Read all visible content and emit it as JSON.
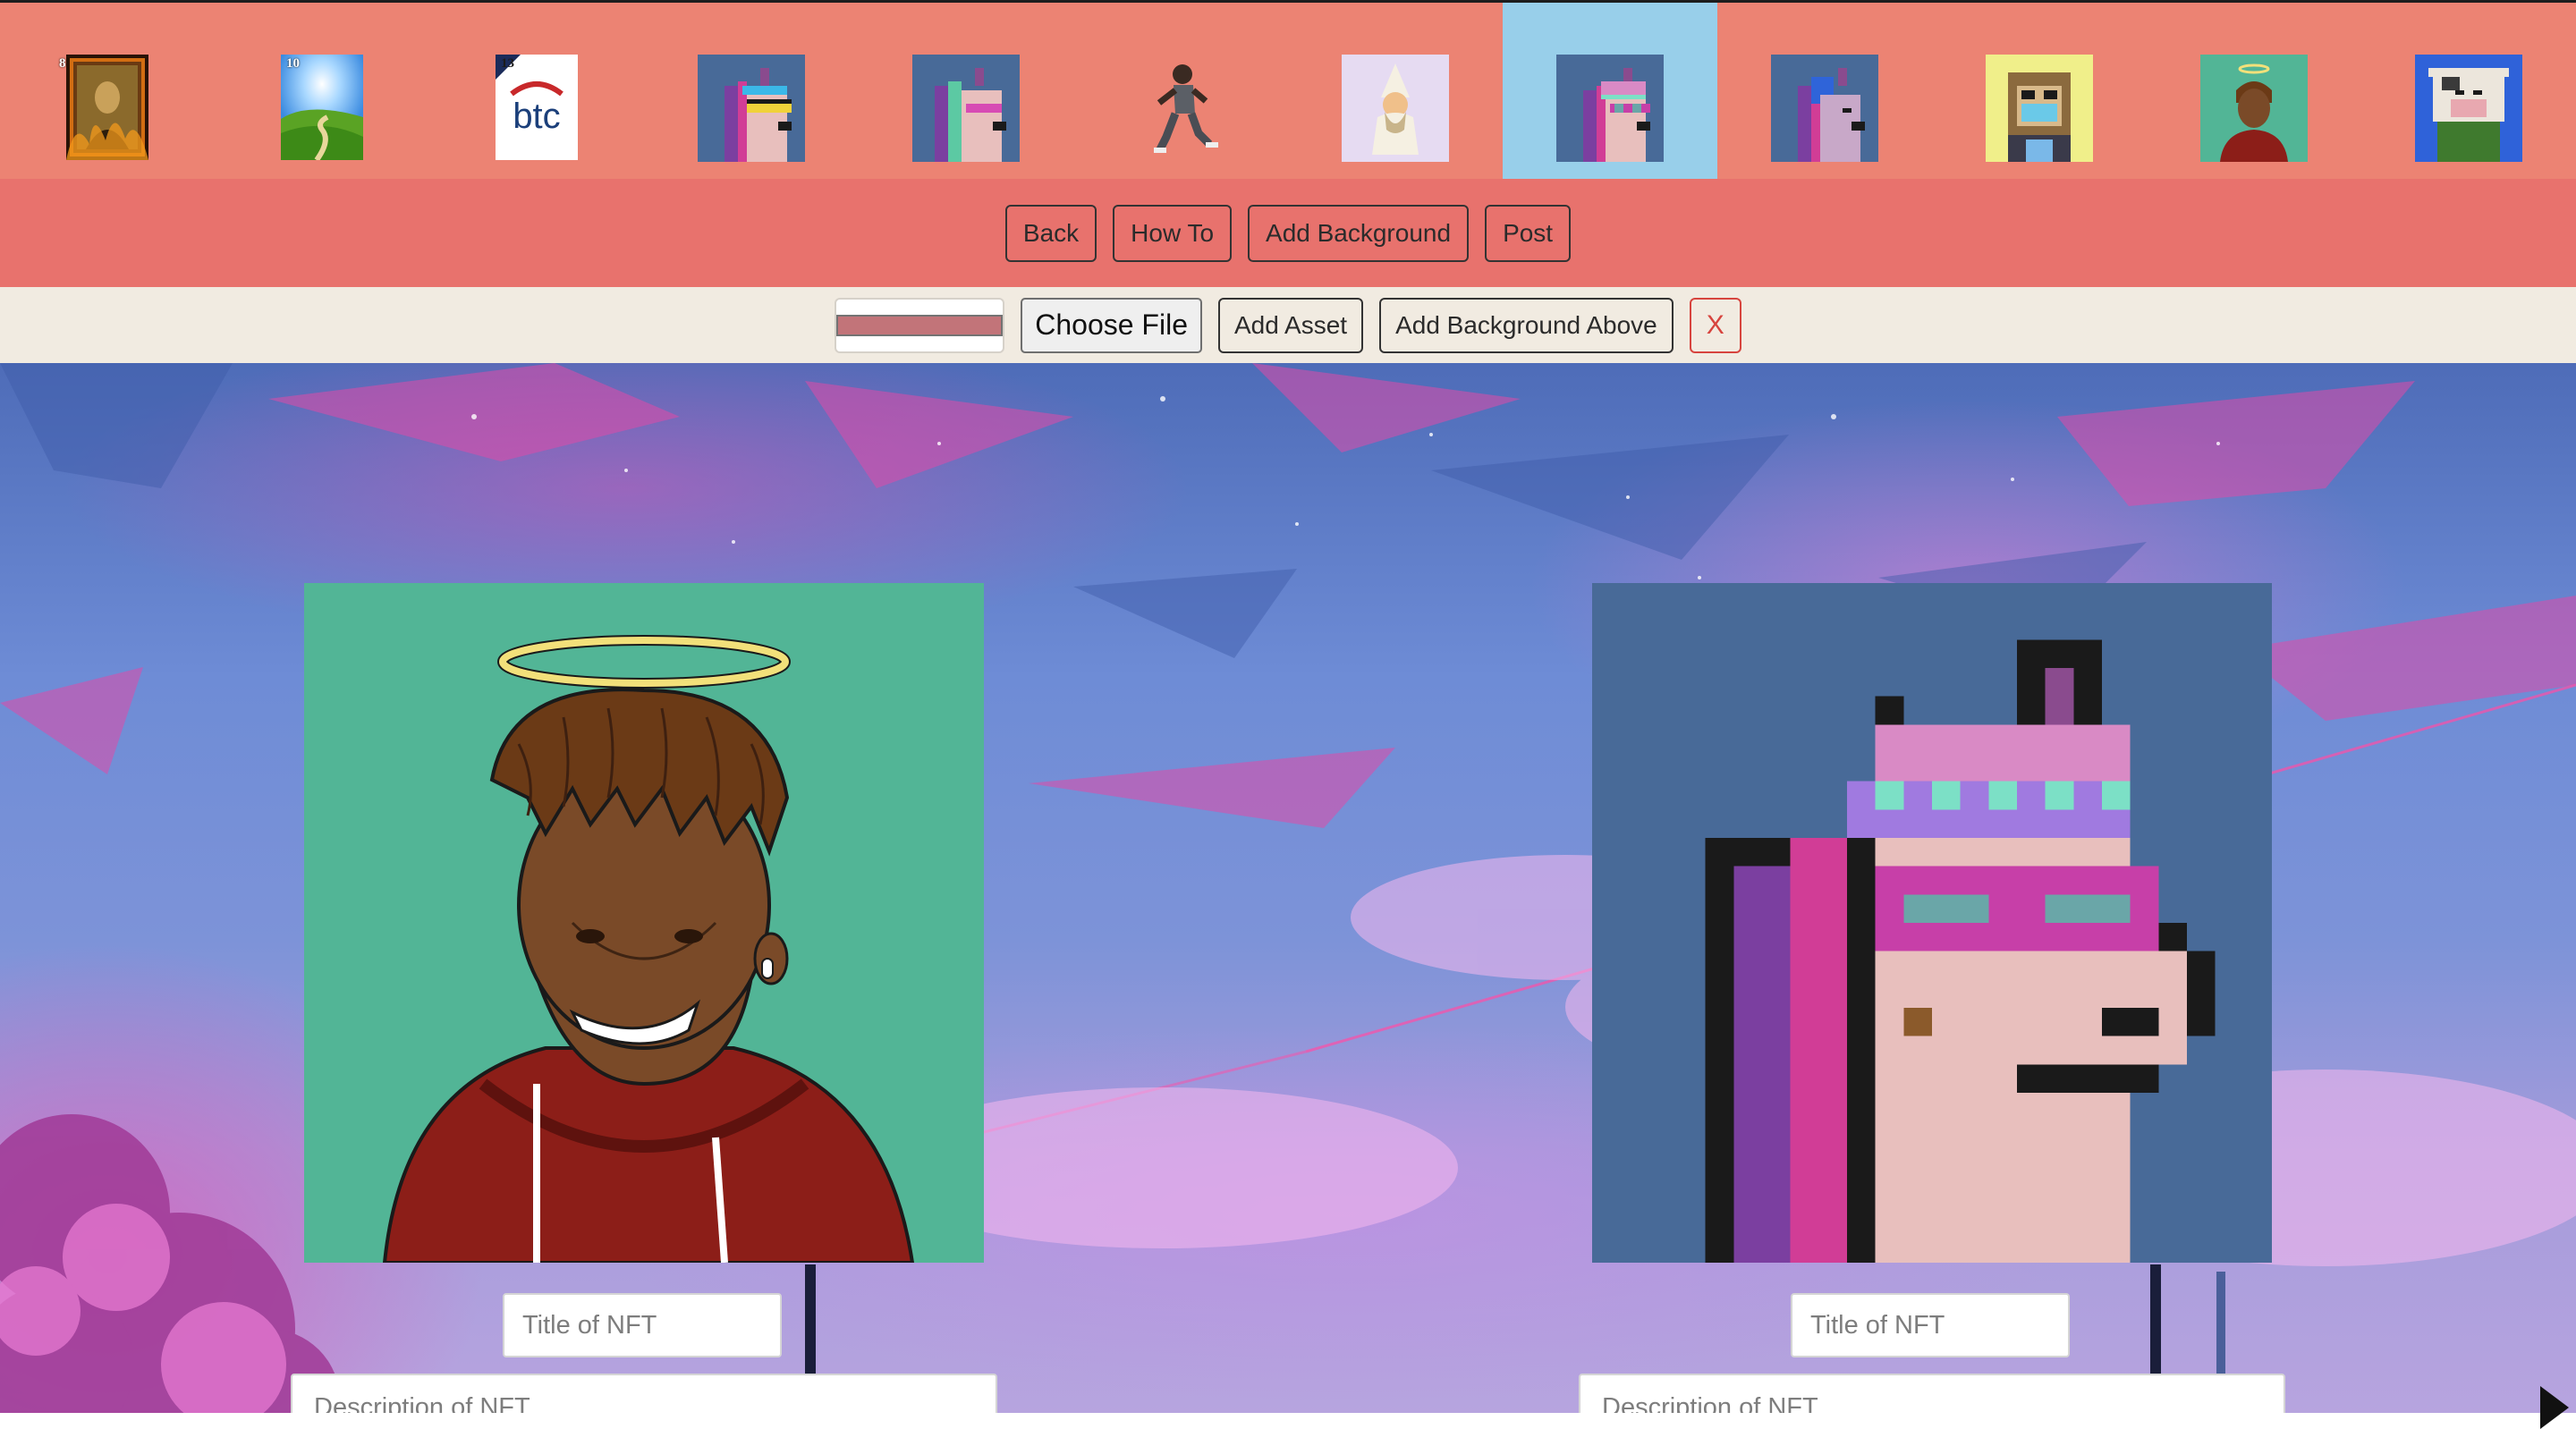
{
  "thumbnails": [
    {
      "name": "mona-lisa-burning-thumbnail",
      "number": "8"
    },
    {
      "name": "green-hills-road-thumbnail",
      "number": "10"
    },
    {
      "name": "btc-logo-thumbnail",
      "number": "13"
    },
    {
      "name": "unicorn-visor-thumbnail"
    },
    {
      "name": "unicorn-green-hair-thumbnail"
    },
    {
      "name": "running-figure-thumbnail"
    },
    {
      "name": "wizard-thumbnail"
    },
    {
      "name": "unicorn-pink-beanie-thumbnail",
      "selected": true
    },
    {
      "name": "unicorn-blue-hair-thumbnail"
    },
    {
      "name": "monkey-mask-thumbnail"
    },
    {
      "name": "angel-portrait-thumbnail"
    },
    {
      "name": "cow-hoodie-thumbnail"
    }
  ],
  "toolbar": {
    "back": "Back",
    "how_to": "How To",
    "add_background": "Add Background",
    "post": "Post"
  },
  "asset_bar": {
    "choose_file": "Choose File",
    "add_asset": "Add Asset",
    "add_background_above": "Add Background Above",
    "close": "X",
    "color_value": "#c27479"
  },
  "cards": [
    {
      "title_placeholder": "Title of NFT",
      "description_placeholder": "Description of NFT"
    },
    {
      "title_placeholder": "Title of NFT",
      "description_placeholder": "Description of NFT"
    }
  ],
  "colors": {
    "strip_bg": "#ec8373",
    "strip_selected": "#98cfea",
    "toolbar_bg": "#e8726d",
    "asset_bar_bg": "#f1ebe1",
    "close_red": "#d7443e"
  }
}
